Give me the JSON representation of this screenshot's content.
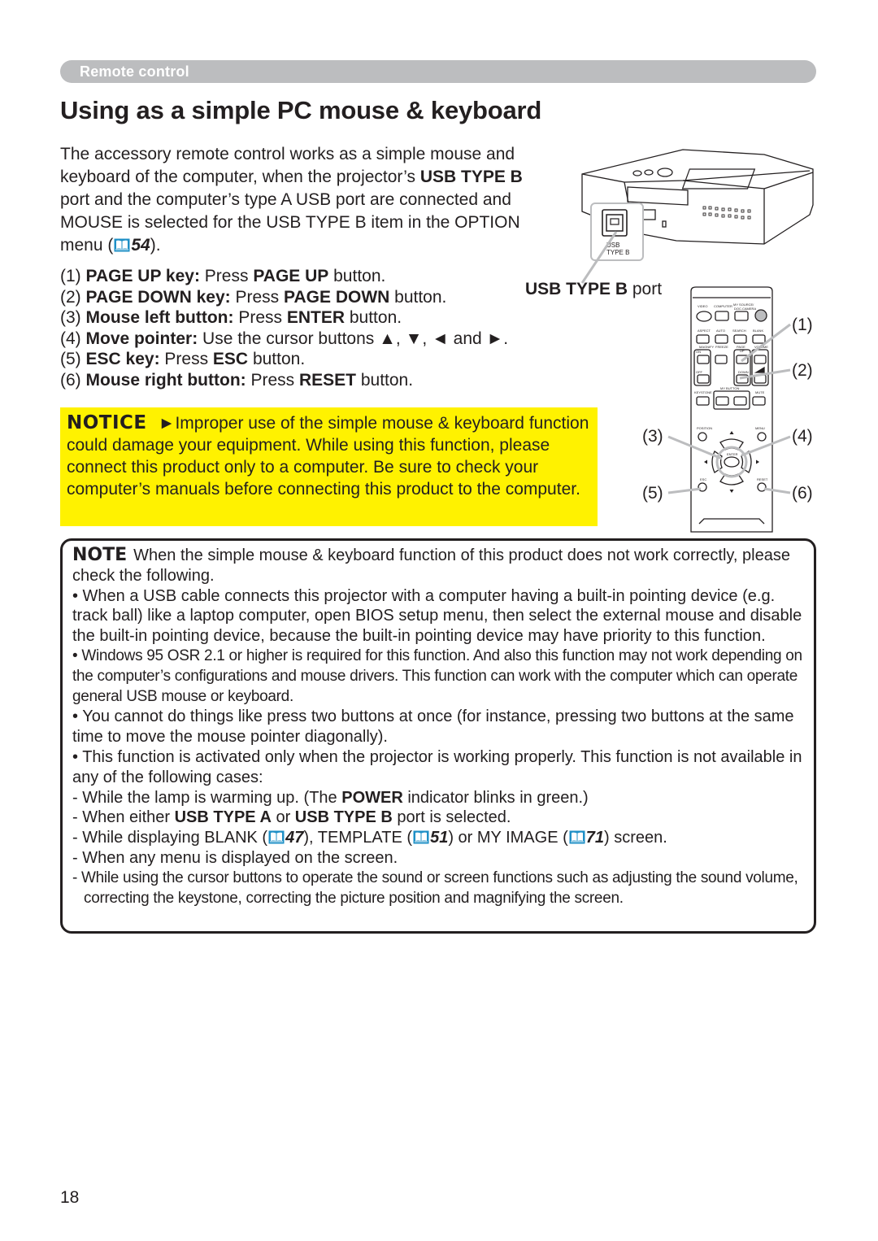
{
  "header": {
    "section": "Remote control"
  },
  "page_title": "Using as a simple PC mouse & keyboard",
  "intro": {
    "parts": [
      "The accessory remote control works as a simple mouse and keyboard of the computer, when the projector’s ",
      "USB TYPE B",
      " port and the computer’s type A USB port are connected and MOUSE is selected for the USB TYPE B item in the OPTION menu (",
      "54",
      ")."
    ]
  },
  "keys": [
    {
      "num": "(1)",
      "label": "PAGE UP key:",
      "pre": " Press ",
      "button": "PAGE UP",
      "post": " button."
    },
    {
      "num": "(2)",
      "label": "PAGE DOWN key:",
      "pre": " Press ",
      "button": "PAGE DOWN",
      "post": " button."
    },
    {
      "num": "(3)",
      "label": "Mouse left button:",
      "pre": " Press ",
      "button": "ENTER",
      "post": " button."
    },
    {
      "num": "(4)",
      "label": "Move pointer:",
      "pre": " Use the cursor buttons ▲, ▼, ◄ and ►.",
      "button": "",
      "post": ""
    },
    {
      "num": "(5)",
      "label": "ESC key:",
      "pre": " Press ",
      "button": "ESC",
      "post": " button."
    },
    {
      "num": "(6)",
      "label": "Mouse right button:",
      "pre": " Press ",
      "button": "RESET",
      "post": " button."
    }
  ],
  "illustration": {
    "usb_port_label_bold": "USB TYPE B",
    "usb_port_label_rest": " port",
    "port_tag_line1": "USB",
    "port_tag_line2": "TYPE B",
    "remote_buttons": {
      "row1": [
        "VIDEO",
        "COMPUTER",
        "MY SOURCE/ DOC.CAMERA"
      ],
      "row2": [
        "ASPECT",
        "AUTO",
        "SEARCH",
        "BLANK"
      ],
      "row3": [
        "MAGNIFY",
        "FREEZE",
        "PAGE UP",
        "VOLUME"
      ],
      "row3_sub": [
        "ON",
        "OFF",
        "DOWN"
      ],
      "row4": [
        "KEYSTONE",
        "MY BUTTON",
        "MUTE"
      ],
      "row4_sub": [
        "1",
        "2"
      ],
      "nav": [
        "POSITION",
        "MENU",
        "ENTER",
        "ESC",
        "RESET"
      ]
    },
    "callouts": [
      "(1)",
      "(2)",
      "(3)",
      "(4)",
      "(5)",
      "(6)"
    ]
  },
  "notice": {
    "tag": "NOTICE",
    "arrow": "►",
    "text": "Improper use of the simple mouse & keyboard function could damage your equipment. While using this function, please connect this product only to a computer. Be sure to check your computer’s manuals before connecting this product to the computer."
  },
  "note": {
    "tag": "NOTE",
    "intro": "When the simple mouse & keyboard function of this product does not work correctly, please check the following.",
    "bullets": [
      "• When a USB cable connects this projector with a computer having a built-in pointing device (e.g. track ball) like a laptop computer, open BIOS setup menu, then select the external mouse and disable the built-in pointing device, because the built-in pointing device may have priority to this function.",
      "• Windows 95 OSR 2.1 or higher is required for this function. And also this function may not work depending on the computer’s configurations and mouse drivers. This function can work with the computer which can operate general USB mouse or keyboard.",
      "• You cannot do things like press two buttons at once (for instance, pressing two buttons at the same time to move the mouse pointer diagonally).",
      "• This function is activated only when the projector is working properly. This function is not available in any of the following cases:"
    ],
    "cases": {
      "c1_pre": "- While the lamp is warming up. (The ",
      "c1_bold": "POWER",
      "c1_post": " indicator blinks in green.)",
      "c2_pre": "- When either ",
      "c2_bold1": "USB TYPE A",
      "c2_mid": " or ",
      "c2_bold2": "USB TYPE B",
      "c2_post": " port is selected.",
      "c3_a": "- While displaying BLANK (",
      "c3_ref1": "47",
      "c3_b": "), TEMPLATE (",
      "c3_ref2": "51",
      "c3_c": ") or MY IMAGE (",
      "c3_ref3": "71",
      "c3_d": ") screen.",
      "c4": "- When any menu is displayed on the screen.",
      "c5": "- While using the cursor buttons to operate the sound or screen functions such as adjusting the sound volume, correcting the keystone, correcting the picture position and magnifying the screen."
    }
  },
  "page_number": "18",
  "colors": {
    "notice_bg": "#fff200",
    "header_bar": "#bcbdbf",
    "book_icon": "#1e8fc6",
    "text": "#231f20"
  }
}
